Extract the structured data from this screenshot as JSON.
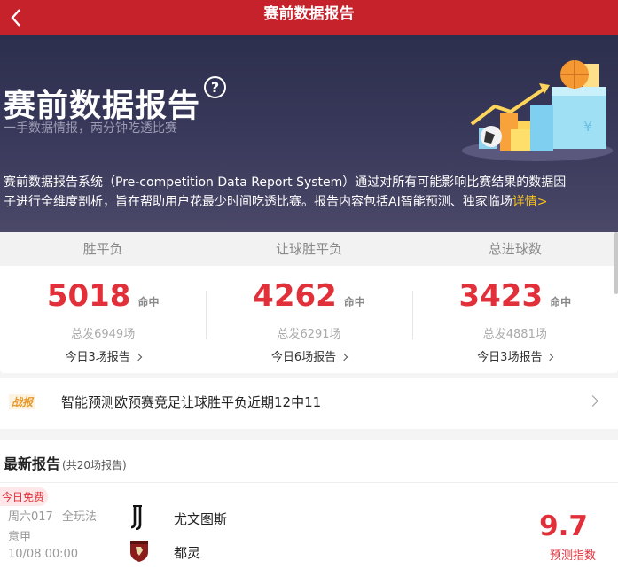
{
  "header": {
    "title": "赛前数据报告"
  },
  "hero": {
    "title": "赛前数据报告",
    "help_symbol": "?",
    "subtitle": "一手数据情报，两分钟吃透比赛",
    "desc_line1": "赛前数据报告系统（Pre-competition Data Report System）通过对所有可能影响比赛结果的数据因",
    "desc_line2": "子进行全维度剖析，旨在帮助用户花最少时间吃透比赛。报告内容包括AI智能预测、独家临场",
    "detail_link": "详情>"
  },
  "stats": {
    "tabs": [
      "胜平负",
      "让球胜平负",
      "总进球数"
    ],
    "columns": [
      {
        "hits": "5018",
        "hit_label": "命中",
        "total": "总发6949场",
        "today": "今日3场报告"
      },
      {
        "hits": "4262",
        "hit_label": "命中",
        "total": "总发6291场",
        "today": "今日6场报告"
      },
      {
        "hits": "3423",
        "hit_label": "命中",
        "total": "总发4881场",
        "today": "今日3场报告"
      }
    ]
  },
  "news": {
    "badge": "战报",
    "text": "智能预测欧预赛竞足让球胜平负近期12中11"
  },
  "latest": {
    "title": "最新报告",
    "count": "(共20场报告)",
    "match": {
      "free_tag": "今日免费",
      "match_no": "周六017",
      "play": "全玩法",
      "league": "意甲",
      "time": "10/08 00:00",
      "home": "尤文图斯",
      "away": "都灵",
      "index": "9.7",
      "index_label": "预测指数"
    }
  },
  "colors": {
    "brand_red": "#c5222b",
    "accent_red": "#e2303a",
    "link_yellow": "#f5c21b",
    "hero_bg": "#2d2f4e"
  }
}
